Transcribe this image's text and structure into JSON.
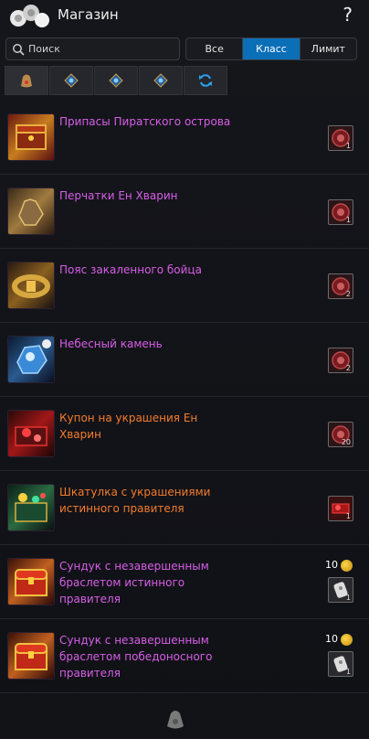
{
  "header": {
    "title": "Магазин",
    "help": "?"
  },
  "search": {
    "placeholder": "Поиск",
    "value": ""
  },
  "filter": {
    "options": [
      "Все",
      "Класс",
      "Лимит"
    ],
    "selected": "Класс"
  },
  "category_tabs": [
    "bag-icon",
    "gem-icon",
    "gem-icon",
    "gem-icon",
    "refresh-icon"
  ],
  "items": [
    {
      "name": "Припасы Пиратского острова",
      "color": "purple",
      "cost_qty": "1"
    },
    {
      "name": "Перчатки Ен Хварин",
      "color": "purple",
      "cost_qty": "1"
    },
    {
      "name": "Пояс закаленного бойца",
      "color": "purple",
      "cost_qty": "2"
    },
    {
      "name": "Небесный камень",
      "color": "purple",
      "cost_qty": "2"
    },
    {
      "name": "Купон на украшения Ен Хварин",
      "color": "orange",
      "cost_qty": "20"
    },
    {
      "name": "Шкатулка с украшениями истинного правителя",
      "color": "orange",
      "cost_qty": "1"
    },
    {
      "name": "Сундук с незавершенным браслетом истинного правителя",
      "color": "purple",
      "gold": "10",
      "cost_qty": "1"
    },
    {
      "name": "Сундук с незавершенным браслетом победоносного правителя",
      "color": "purple",
      "gold": "10",
      "cost_qty": "1"
    }
  ],
  "colors": {
    "purple": "#d85ee8",
    "orange": "#f47c2c",
    "accent": "#0b6fb8"
  }
}
